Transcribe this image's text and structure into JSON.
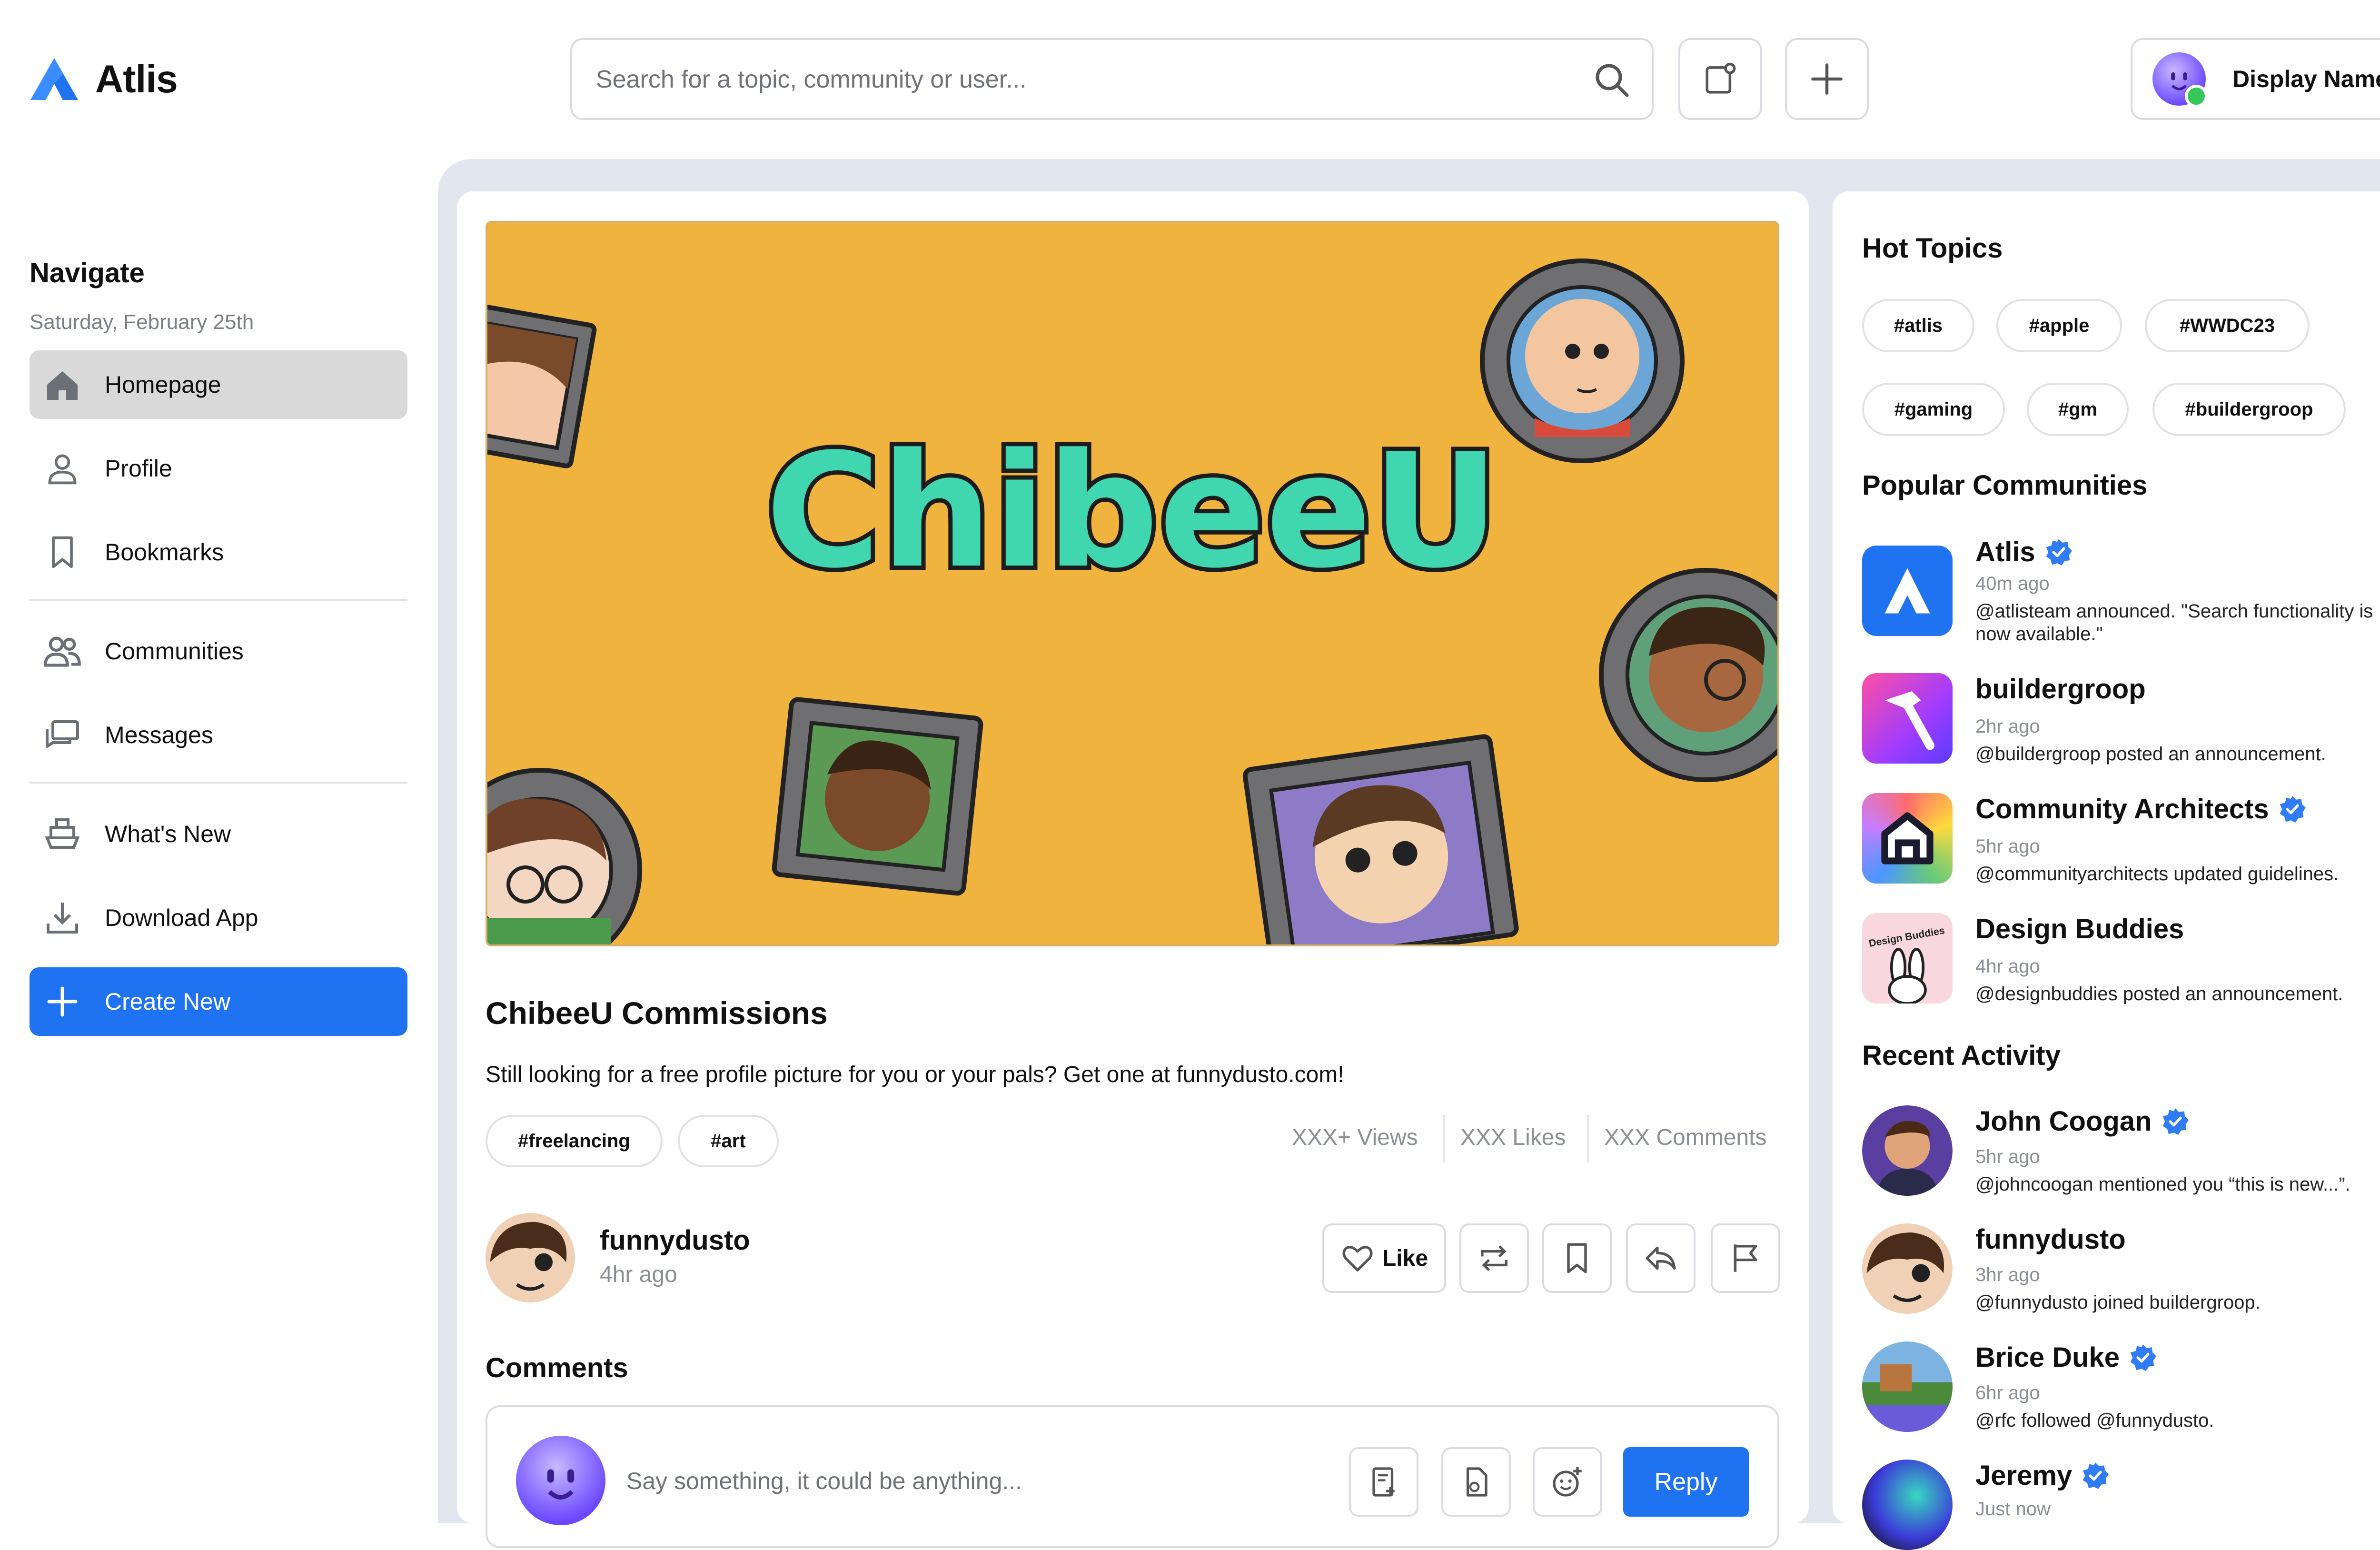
{
  "app": {
    "name": "Atlis"
  },
  "header": {
    "search_placeholder": "Search for a topic, community or user...",
    "user_name": "Display Name"
  },
  "nav": {
    "title": "Navigate",
    "date": "Saturday, February 25th",
    "items": [
      {
        "label": "Homepage",
        "icon": "home-icon"
      },
      {
        "label": "Profile",
        "icon": "user-icon"
      },
      {
        "label": "Bookmarks",
        "icon": "bookmark-icon"
      },
      {
        "label": "Communities",
        "icon": "people-icon"
      },
      {
        "label": "Messages",
        "icon": "messages-icon"
      },
      {
        "label": "What's New",
        "icon": "ship-icon"
      },
      {
        "label": "Download App",
        "icon": "download-icon"
      }
    ],
    "create_label": "Create New"
  },
  "post": {
    "banner_text": "ChibeeU",
    "title": "ChibeeU Commissions",
    "body": "Still looking for a free profile picture for you or your pals? Get one at funnydusto.com!",
    "tags": [
      "#freelancing",
      "#art"
    ],
    "stats": {
      "views": "XXX+ Views",
      "likes": "XXX Likes",
      "comments": "XXX Comments"
    },
    "author": {
      "name": "funnydusto",
      "time": "4hr ago"
    },
    "like_label": "Like"
  },
  "comments": {
    "title": "Comments",
    "placeholder": "Say something, it could be anything...",
    "reply_label": "Reply"
  },
  "sidebar": {
    "hot_topics_title": "Hot Topics",
    "hot_topics": [
      "#atlis",
      "#apple",
      "#WWDC23",
      "#gaming",
      "#gm",
      "#buildergroop"
    ],
    "popular_title": "Popular Communities",
    "communities": [
      {
        "name": "Atlis",
        "time": "40m ago",
        "desc": "@atlisteam announced. \"Search functionality is now available.\""
      },
      {
        "name": "buildergroop",
        "time": "2hr ago",
        "desc": "@buildergroop posted an announcement."
      },
      {
        "name": "Community Architects",
        "time": "5hr ago",
        "desc": "@communityarchitects updated guidelines."
      },
      {
        "name": "Design Buddies",
        "time": "4hr ago",
        "desc": "@designbuddies posted an announcement."
      }
    ],
    "design_buddies_logo_text": "Design Buddies",
    "recent_title": "Recent Activity",
    "activity": [
      {
        "name": "John Coogan",
        "time": "5hr ago",
        "desc": "@johncoogan mentioned you “this is new...”."
      },
      {
        "name": "funnydusto",
        "time": "3hr ago",
        "desc": "@funnydusto joined buildergroop."
      },
      {
        "name": "Brice Duke",
        "time": "6hr ago",
        "desc": "@rfc followed @funnydusto."
      },
      {
        "name": "Jeremy",
        "time": "Just now",
        "desc": ""
      }
    ]
  },
  "colors": {
    "accent": "#1f73f1",
    "verified": "#2f7cf6",
    "banner_bg": "#f0b33d",
    "online": "#34c759"
  }
}
